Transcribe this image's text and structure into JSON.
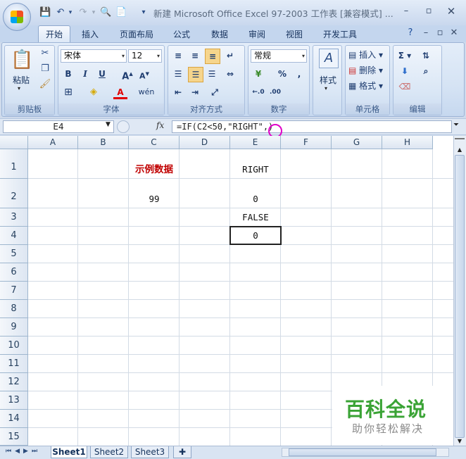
{
  "window": {
    "title": "新建 Microsoft Office Excel 97-2003 工作表 [兼容模式] ...",
    "quick_access": [
      "save-icon",
      "undo-icon",
      "redo-icon",
      "print-preview-icon",
      "new-icon"
    ]
  },
  "tabs": [
    "开始",
    "插入",
    "页面布局",
    "公式",
    "数据",
    "审阅",
    "视图",
    "开发工具"
  ],
  "active_tab": "开始",
  "ribbon": {
    "clipboard": {
      "label": "剪贴板",
      "paste": "粘贴"
    },
    "font": {
      "label": "字体",
      "font_name": "宋体",
      "font_size": "12",
      "bold": "B",
      "italic": "I",
      "underline": "U",
      "phonetic": "wén"
    },
    "alignment": {
      "label": "对齐方式"
    },
    "number": {
      "label": "数字",
      "format": "常规",
      "percent": "%",
      "comma": ","
    },
    "styles": {
      "label": "样式"
    },
    "cells": {
      "label": "单元格",
      "insert": "插入",
      "delete": "删除",
      "format": "格式"
    },
    "editing": {
      "label": "编辑"
    }
  },
  "formula_bar": {
    "name_box": "E4",
    "fx": "fx",
    "formula": "=IF(C2<50,\"RIGHT\",)"
  },
  "columns": [
    "A",
    "B",
    "C",
    "D",
    "E",
    "F",
    "G",
    "H"
  ],
  "rows": [
    "1",
    "2",
    "3",
    "4",
    "5",
    "6",
    "7",
    "8",
    "9",
    "10",
    "11",
    "12",
    "13",
    "14",
    "15"
  ],
  "cells": {
    "C1": "示例数据",
    "E1": "RIGHT",
    "C2": "99",
    "E2": "0",
    "E3": "FALSE",
    "E4": "0"
  },
  "sheets": [
    "Sheet1",
    "Sheet2",
    "Sheet3"
  ],
  "watermark": {
    "title": "百科全说",
    "subtitle": "助你轻松解决"
  },
  "colors": {
    "header_text_red": "#c00000",
    "watermark_green": "#3aa335"
  }
}
